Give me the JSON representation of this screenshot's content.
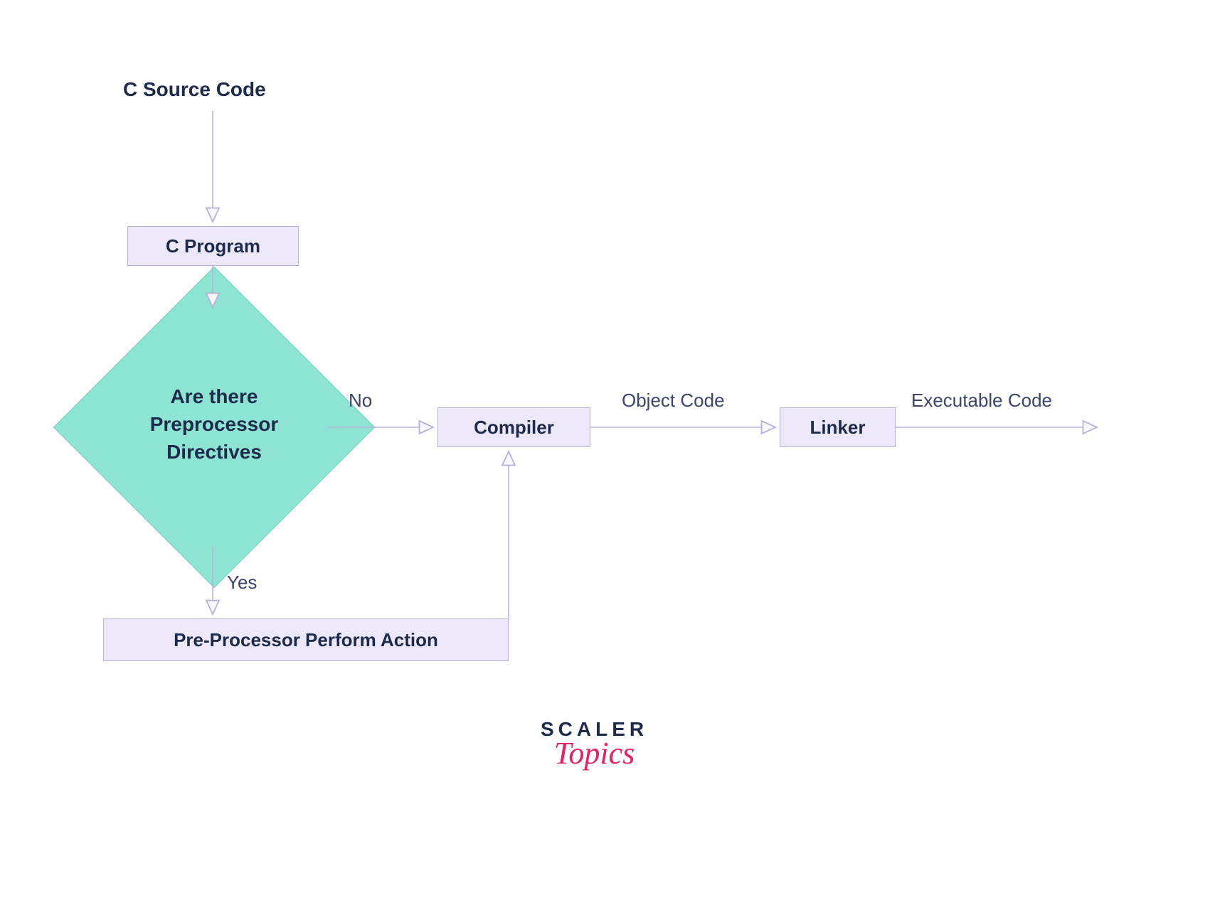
{
  "title": "C Source Code",
  "nodes": {
    "c_program": "C Program",
    "decision": "Are there\nPreprocessor\nDirectives",
    "preprocessor": "Pre-Processor Perform Action",
    "compiler": "Compiler",
    "linker": "Linker"
  },
  "edges": {
    "no": "No",
    "yes": "Yes",
    "object_code": "Object Code",
    "executable_code": "Executable Code"
  },
  "logo": {
    "line1": "SCALER",
    "line2": "Topics"
  }
}
